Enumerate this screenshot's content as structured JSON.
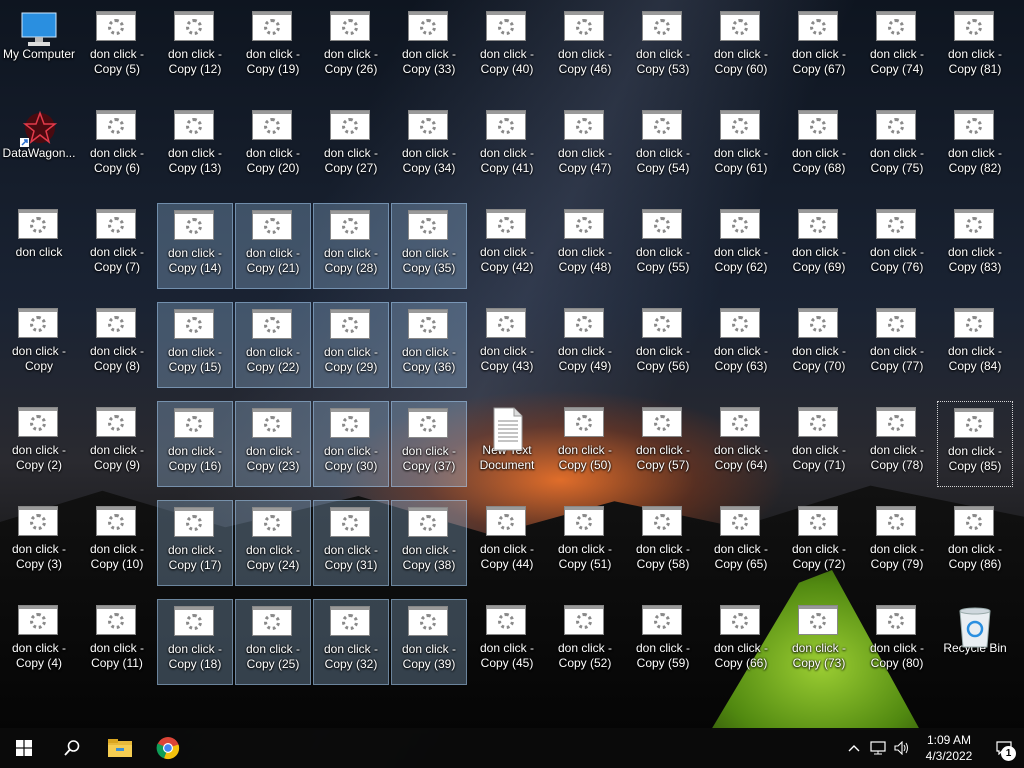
{
  "desktop": {
    "my_computer": "My Computer",
    "datawagon": "DataWagon...",
    "don_click": "don click",
    "copy_line1": "don click -",
    "copy_plain": "Copy",
    "new_text_line1": "New Text",
    "new_text_line2": "Document",
    "recycle_bin": "Recycle Bin",
    "copies": [
      "Copy (2)",
      "Copy (3)",
      "Copy (4)",
      "Copy (5)",
      "Copy (6)",
      "Copy (7)",
      "Copy (8)",
      "Copy (9)",
      "Copy (10)",
      "Copy (11)",
      "Copy (12)",
      "Copy (13)",
      "Copy (14)",
      "Copy (15)",
      "Copy (16)",
      "Copy (17)",
      "Copy (18)",
      "Copy (19)",
      "Copy (20)",
      "Copy (21)",
      "Copy (22)",
      "Copy (23)",
      "Copy (24)",
      "Copy (25)",
      "Copy (26)",
      "Copy (27)",
      "Copy (28)",
      "Copy (29)",
      "Copy (30)",
      "Copy (31)",
      "Copy (32)",
      "Copy (33)",
      "Copy (34)",
      "Copy (35)",
      "Copy (36)",
      "Copy (37)",
      "Copy (38)",
      "Copy (39)",
      "Copy (40)",
      "Copy (41)",
      "Copy (42)",
      "Copy (43)",
      "Copy (44)",
      "Copy (45)",
      "Copy (46)",
      "Copy (47)",
      "Copy (48)",
      "Copy (49)",
      "Copy (50)",
      "Copy (51)",
      "Copy (52)",
      "Copy (53)",
      "Copy (54)",
      "Copy (55)",
      "Copy (56)",
      "Copy (57)",
      "Copy (58)",
      "Copy (59)",
      "Copy (60)",
      "Copy (61)",
      "Copy (62)",
      "Copy (63)",
      "Copy (64)",
      "Copy (65)",
      "Copy (66)",
      "Copy (67)",
      "Copy (68)",
      "Copy (69)",
      "Copy (70)",
      "Copy (71)",
      "Copy (72)",
      "Copy (73)",
      "Copy (74)",
      "Copy (75)",
      "Copy (76)",
      "Copy (77)",
      "Copy (78)",
      "Copy (79)",
      "Copy (80)",
      "Copy (81)",
      "Copy (82)",
      "Copy (83)",
      "Copy (84)",
      "Copy (85)",
      "Copy (86)"
    ],
    "selected": [
      "Copy (14)",
      "Copy (15)",
      "Copy (16)",
      "Copy (17)",
      "Copy (18)",
      "Copy (21)",
      "Copy (22)",
      "Copy (23)",
      "Copy (24)",
      "Copy (25)",
      "Copy (28)",
      "Copy (29)",
      "Copy (30)",
      "Copy (31)",
      "Copy (32)",
      "Copy (35)",
      "Copy (36)",
      "Copy (37)",
      "Copy (38)",
      "Copy (39)"
    ],
    "focused": "Copy (85)"
  },
  "taskbar": {
    "start_icon": "windows-logo-icon",
    "search_icon": "search-icon",
    "explorer_icon": "file-explorer-icon",
    "chrome_icon": "chrome-icon",
    "time": "1:09 AM",
    "date": "4/3/2022",
    "notification_count": "1"
  }
}
